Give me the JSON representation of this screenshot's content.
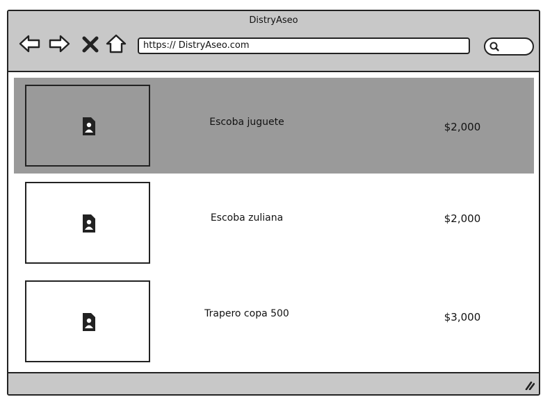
{
  "window": {
    "title": "DistryAseo"
  },
  "toolbar": {
    "back_icon": "back-arrow-icon",
    "forward_icon": "forward-arrow-icon",
    "stop_icon": "close-icon",
    "home_icon": "home-icon",
    "search_icon": "search-icon"
  },
  "address_bar": {
    "url": "https:// DistryAseo.com"
  },
  "products": [
    {
      "name": "Escoba juguete",
      "price": "$2,000",
      "selected": true,
      "image_icon": "image-placeholder-icon"
    },
    {
      "name": "Escoba zuliana",
      "price": "$2,000",
      "selected": false,
      "image_icon": "image-placeholder-icon"
    },
    {
      "name": "Trapero copa 500",
      "price": "$3,000",
      "selected": false,
      "image_icon": "image-placeholder-icon"
    }
  ],
  "colors": {
    "chrome": "#c8c8c8",
    "selected_row": "#9a9a9a",
    "border": "#222222",
    "background": "#ffffff"
  }
}
